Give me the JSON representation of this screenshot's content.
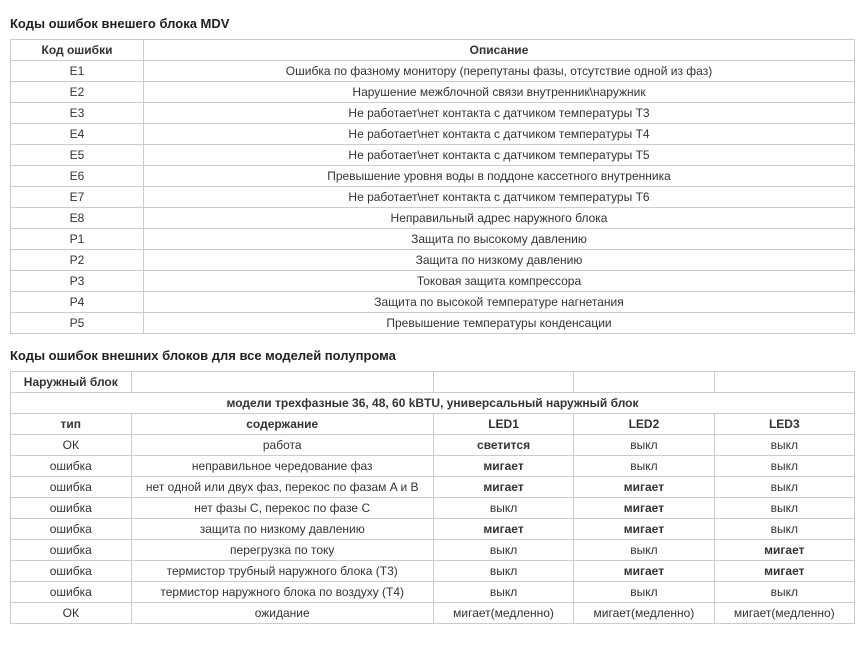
{
  "section1": {
    "title": "Коды ошибок внешего блока MDV",
    "headers": {
      "code": "Код ошибки",
      "desc": "Описание"
    },
    "rows": [
      {
        "code": "E1",
        "desc": "Ошибка по фазному монитору (перепутаны фазы, отсутствие одной из фаз)"
      },
      {
        "code": "E2",
        "desc": "Нарушение межблочной связи внутренник\\наружник"
      },
      {
        "code": "E3",
        "desc": "Не работает\\нет контакта с датчиком температуры T3"
      },
      {
        "code": "E4",
        "desc": "Не работает\\нет контакта с датчиком температуры T4"
      },
      {
        "code": "E5",
        "desc": "Не работает\\нет контакта с датчиком температуры T5"
      },
      {
        "code": "E6",
        "desc": "Превышение уровня воды в поддоне кассетного внутренника"
      },
      {
        "code": "E7",
        "desc": "Не работает\\нет контакта с датчиком температуры T6"
      },
      {
        "code": "E8",
        "desc": "Неправильный адрес наружного блока"
      },
      {
        "code": "P1",
        "desc": "Защита по высокому давлению"
      },
      {
        "code": "P2",
        "desc": "Защита по низкому давлению"
      },
      {
        "code": "P3",
        "desc": "Токовая защита компрессора"
      },
      {
        "code": "P4",
        "desc": "Защита по высокой температуре нагнетания"
      },
      {
        "code": "P5",
        "desc": "Превышение температуры конденсации"
      }
    ]
  },
  "section2": {
    "title": "Коды ошибок внешних блоков для все моделей полупрома",
    "outer_header": "Наружный блок",
    "model_header": "модели трехфазные 36, 48, 60 kBTU, универсальный наружный блок",
    "col_headers": {
      "type": "тип",
      "content": "содержание",
      "led1": "LED1",
      "led2": "LED2",
      "led3": "LED3"
    },
    "rows": [
      {
        "type": "ОК",
        "content": "работа",
        "led1": "светится",
        "led2": "выкл",
        "led3": "выкл",
        "bold": [
          2
        ]
      },
      {
        "type": "ошибка",
        "content": "неправильное чередование фаз",
        "led1": "мигает",
        "led2": "выкл",
        "led3": "выкл",
        "bold": [
          2
        ]
      },
      {
        "type": "ошибка",
        "content": "нет одной или двух фаз, перекос по фазам A и B",
        "led1": "мигает",
        "led2": "мигает",
        "led3": "выкл",
        "bold": [
          2,
          3
        ]
      },
      {
        "type": "ошибка",
        "content": "нет фазы С, перекос по фазе С",
        "led1": "выкл",
        "led2": "мигает",
        "led3": "выкл",
        "bold": [
          3
        ]
      },
      {
        "type": "ошибка",
        "content": "защита по низкому давлению",
        "led1": "мигает",
        "led2": "мигает",
        "led3": "выкл",
        "bold": [
          2,
          3
        ]
      },
      {
        "type": "ошибка",
        "content": "перегрузка по току",
        "led1": "выкл",
        "led2": "выкл",
        "led3": "мигает",
        "bold": [
          4
        ]
      },
      {
        "type": "ошибка",
        "content": "термистор трубный наружного блока (Т3)",
        "led1": "выкл",
        "led2": "мигает",
        "led3": "мигает",
        "bold": [
          3,
          4
        ]
      },
      {
        "type": "ошибка",
        "content": "термистор наружного блока по воздуху (Т4)",
        "led1": "выкл",
        "led2": "выкл",
        "led3": "выкл",
        "bold": []
      },
      {
        "type": "ОК",
        "content": "ожидание",
        "led1": "мигает(медленно)",
        "led2": "мигает(медленно)",
        "led3": "мигает(медленно)",
        "bold": []
      }
    ]
  }
}
